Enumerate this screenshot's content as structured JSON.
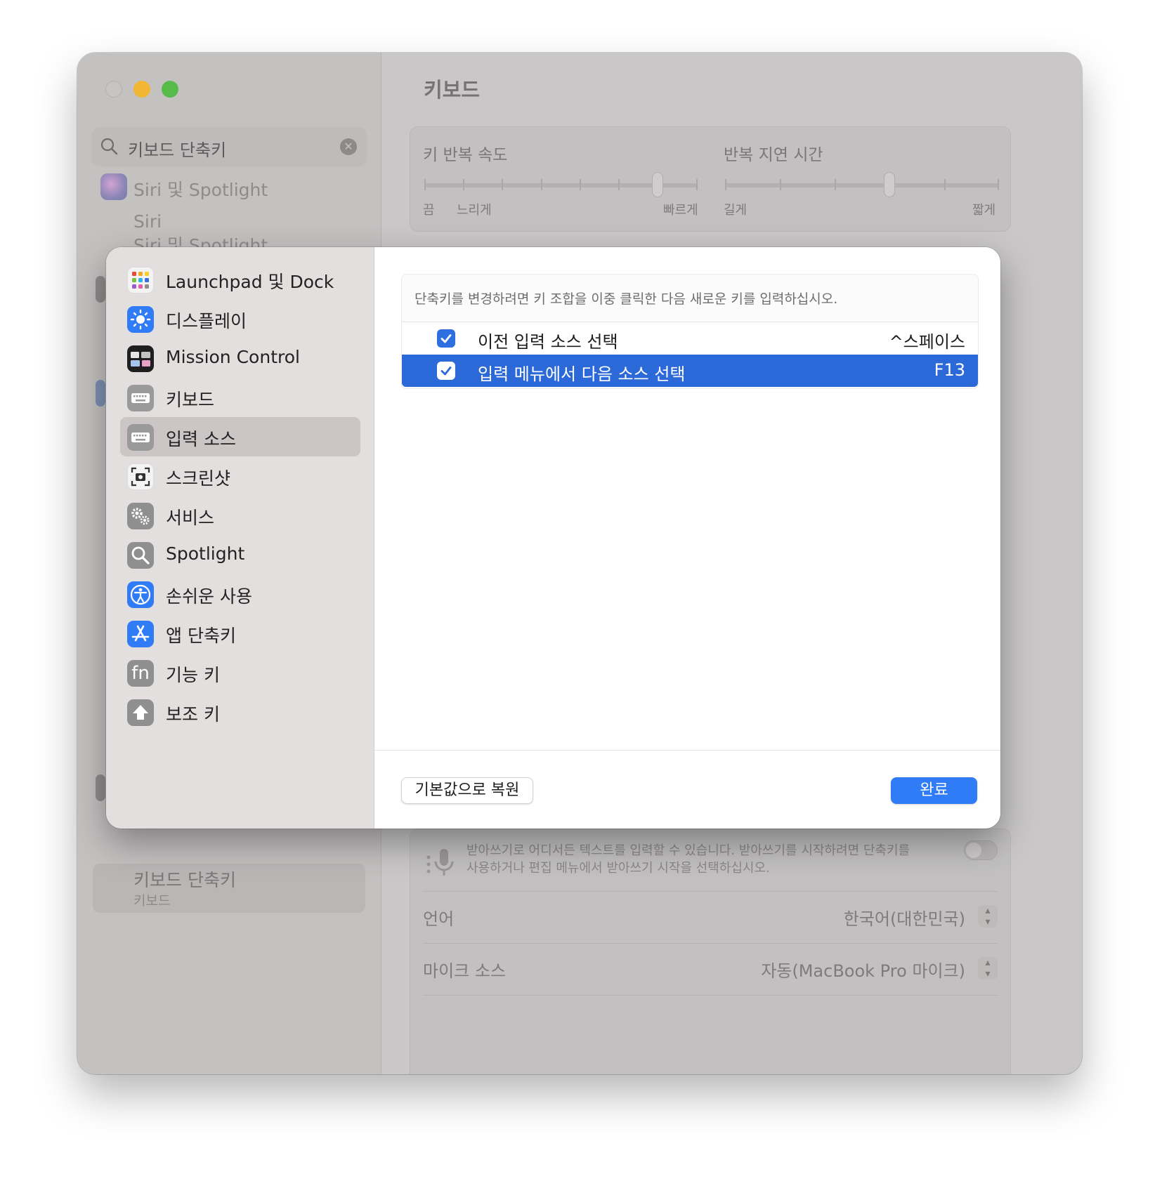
{
  "window": {
    "title": "키보드",
    "search": {
      "value": "키보드 단축키"
    },
    "background_sidebar": {
      "result1_title": "Siri 및 Spotlight",
      "result1_sub1": "Siri",
      "result1_sub2": "Siri 및 Spotlight",
      "selected_title": "키보드 단축키",
      "selected_sub": "키보드"
    },
    "keyboard_section": {
      "repeat_rate": {
        "title": "키 반복 속도",
        "left_label": "끔",
        "mid_label": "느리게",
        "right_label": "빠르게",
        "value_steps_from_left": 7,
        "ticks": 8
      },
      "repeat_delay": {
        "title": "반복 지연 시간",
        "left_label": "길게",
        "right_label": "짧게",
        "value_steps_from_left": 3,
        "ticks": 6
      }
    },
    "dictation_section": {
      "description": "받아쓰기로 어디서든 텍스트를 입력할 수 있습니다. 받아쓰기를 시작하려면 단축키를 사용하거나 편집 메뉴에서 받아쓰기 시작을 선택하십시오.",
      "toggle_on": false,
      "language_label": "언어",
      "language_value": "한국어(대한민국)",
      "mic_label": "마이크 소스",
      "mic_value": "자동(MacBook Pro 마이크)"
    }
  },
  "dialog": {
    "sidebar": [
      {
        "label": "Launchpad 및 Dock",
        "icon": "launchpad-icon",
        "selected": false
      },
      {
        "label": "디스플레이",
        "icon": "display-brightness-icon",
        "selected": false
      },
      {
        "label": "Mission Control",
        "icon": "mission-control-icon",
        "selected": false
      },
      {
        "label": "키보드",
        "icon": "keyboard-icon",
        "selected": false
      },
      {
        "label": "입력 소스",
        "icon": "input-sources-icon",
        "selected": true
      },
      {
        "label": "스크린샷",
        "icon": "screenshot-icon",
        "selected": false
      },
      {
        "label": "서비스",
        "icon": "gears-icon",
        "selected": false
      },
      {
        "label": "Spotlight",
        "icon": "magnifier-icon",
        "selected": false
      },
      {
        "label": "손쉬운 사용",
        "icon": "accessibility-icon",
        "selected": false
      },
      {
        "label": "앱 단축키",
        "icon": "app-store-icon",
        "selected": false
      },
      {
        "label": "기능 키",
        "icon": "fn-key-icon",
        "selected": false
      },
      {
        "label": "보조 키",
        "icon": "modifier-key-icon",
        "selected": false
      }
    ],
    "fn_glyph": "fn",
    "hint": "단축키를 변경하려면 키 조합을 이중 클릭한 다음 새로운 키를 입력하십시오.",
    "shortcuts": [
      {
        "label": "이전 입력 소스 선택",
        "key": "^스페이스",
        "checked": true,
        "selected": false
      },
      {
        "label": "입력 메뉴에서 다음 소스 선택",
        "key": "F13",
        "checked": true,
        "selected": true
      }
    ],
    "restore_button": "기본값으로 복원",
    "done_button": "완료"
  },
  "colors": {
    "accent": "#2f7cf6",
    "selection": "#2b69d9",
    "traffic_min": "#f2b635",
    "traffic_max": "#57bb4a"
  }
}
